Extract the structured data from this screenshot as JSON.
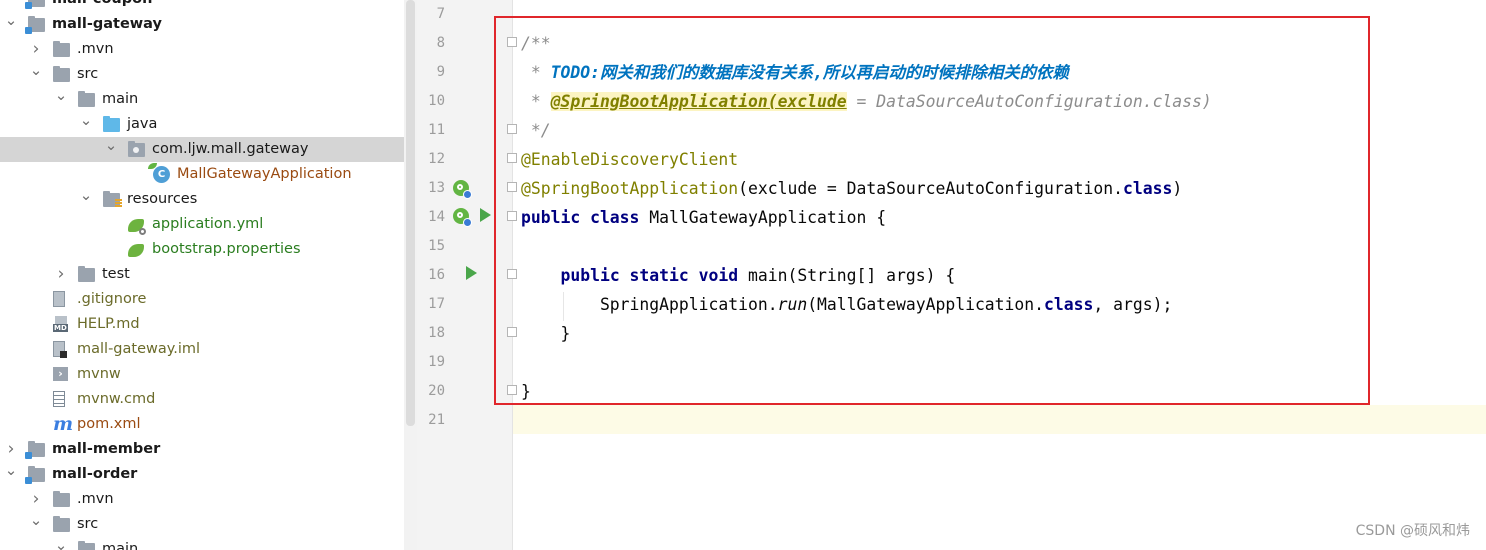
{
  "tree": {
    "items": [
      {
        "label": "mall-coupon",
        "icon": "module-folder-icon",
        "arrow": "",
        "style": "bold"
      },
      {
        "label": "mall-gateway",
        "icon": "module-folder-icon",
        "arrow": "expanded",
        "style": "bold"
      },
      {
        "label": ".mvn",
        "icon": "folder-icon",
        "arrow": "collapsed",
        "style": ""
      },
      {
        "label": "src",
        "icon": "folder-icon",
        "arrow": "expanded",
        "style": ""
      },
      {
        "label": "main",
        "icon": "folder-icon",
        "arrow": "expanded",
        "style": ""
      },
      {
        "label": "java",
        "icon": "source-folder-icon",
        "arrow": "expanded",
        "style": ""
      },
      {
        "label": "com.ljw.mall.gateway",
        "icon": "package-icon",
        "arrow": "expanded",
        "style": "",
        "selected": true
      },
      {
        "label": "MallGatewayApplication",
        "icon": "spring-class-icon",
        "arrow": "",
        "style": "brown"
      },
      {
        "label": "resources",
        "icon": "resources-folder-icon",
        "arrow": "expanded",
        "style": ""
      },
      {
        "label": "application.yml",
        "icon": "spring-config-icon",
        "arrow": "",
        "style": "green"
      },
      {
        "label": "bootstrap.properties",
        "icon": "spring-leaf-icon",
        "arrow": "",
        "style": "green"
      },
      {
        "label": "test",
        "icon": "folder-icon",
        "arrow": "collapsed",
        "style": ""
      },
      {
        "label": ".gitignore",
        "icon": "file-icon",
        "arrow": "",
        "style": "olive"
      },
      {
        "label": "HELP.md",
        "icon": "markdown-icon",
        "arrow": "",
        "style": "olive"
      },
      {
        "label": "mall-gateway.iml",
        "icon": "iml-file-icon",
        "arrow": "",
        "style": "olive"
      },
      {
        "label": "mvnw",
        "icon": "terminal-icon",
        "arrow": "",
        "style": "olive"
      },
      {
        "label": "mvnw.cmd",
        "icon": "cmd-file-icon",
        "arrow": "",
        "style": "olive"
      },
      {
        "label": "pom.xml",
        "icon": "maven-icon",
        "arrow": "",
        "style": "brown"
      },
      {
        "label": "mall-member",
        "icon": "module-folder-icon",
        "arrow": "collapsed",
        "style": "bold"
      },
      {
        "label": "mall-order",
        "icon": "module-folder-icon",
        "arrow": "expanded",
        "style": "bold"
      },
      {
        "label": ".mvn",
        "icon": "folder-icon",
        "arrow": "collapsed",
        "style": ""
      },
      {
        "label": "src",
        "icon": "folder-icon",
        "arrow": "expanded",
        "style": ""
      },
      {
        "label": "main",
        "icon": "folder-icon",
        "arrow": "expanded",
        "style": ""
      }
    ]
  },
  "editor": {
    "line_numbers": [
      "7",
      "8",
      "9",
      "10",
      "11",
      "12",
      "13",
      "14",
      "15",
      "16",
      "17",
      "18",
      "19",
      "20",
      "21"
    ],
    "l8": "/**",
    "l9_star": " * ",
    "l9_todo": "TODO:网关和我们的数据库没有关系,所以再启动的时候排除相关的依赖",
    "l10_star": " * ",
    "l10_tag": "@SpringBootApplication(exclude",
    "l10_rest": " = DataSourceAutoConfiguration.class)",
    "l11": " */",
    "l12": "@EnableDiscoveryClient",
    "l13_ann": "@SpringBootApplication",
    "l13_a": "(exclude = DataSourceAutoConfiguration.",
    "l13_kw": "class",
    "l13_b": ")",
    "l14_kw": "public class ",
    "l14_rest": "MallGatewayApplication {",
    "l16_indent": "    ",
    "l16_kw": "public static void ",
    "l16_rest": "main(String[] args) {",
    "l17_a": "        SpringApplication.",
    "l17_run": "run",
    "l17_b": "(MallGatewayApplication.",
    "l17_kw": "class",
    "l17_c": ", args);",
    "l18": "    }",
    "l20": "}"
  },
  "colors": {
    "highlight_box": "#e0262b",
    "keyword": "#000080",
    "annotation": "#808000",
    "todo": "#0073bf"
  },
  "watermark": "CSDN @硕风和炜"
}
